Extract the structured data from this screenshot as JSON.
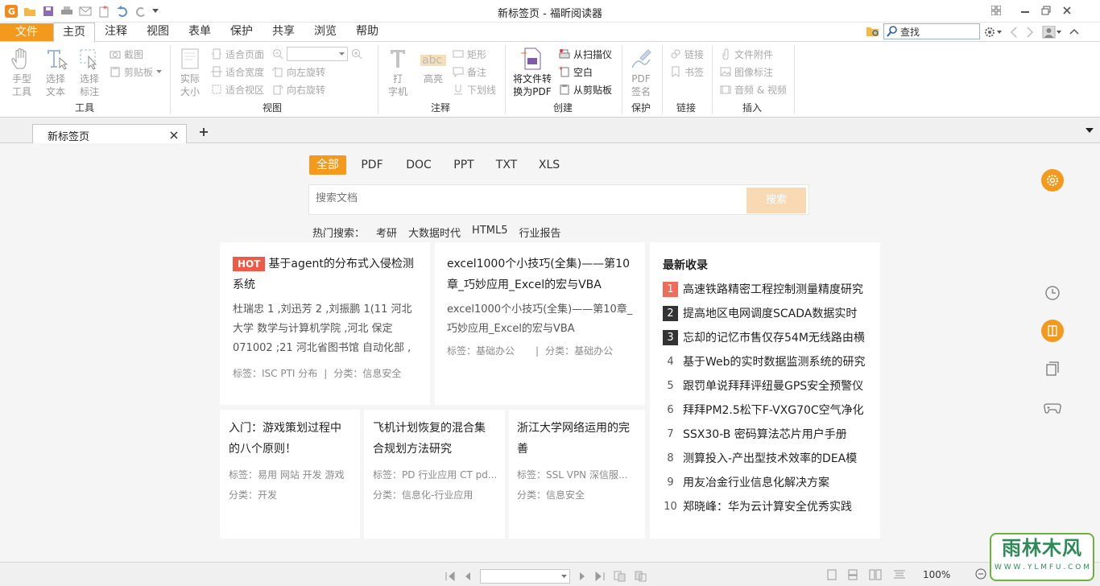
{
  "app": {
    "title": "新标签页 - 福昕阅读器"
  },
  "menu": {
    "tabs": [
      "文件",
      "主页",
      "注释",
      "视图",
      "表单",
      "保护",
      "共享",
      "浏览",
      "帮助"
    ],
    "search_placeholder": "查找"
  },
  "ribbon": {
    "tools": {
      "hand": "手型\n工具",
      "select_text": "选择\n文本",
      "select_annot": "选择\n标注",
      "snapshot": "截图",
      "clipboard": "剪贴板",
      "group": "工具"
    },
    "view": {
      "actual_size": "实际\n大小",
      "fit_page": "适合页面",
      "fit_width": "适合宽度",
      "fit_visible": "适合视区",
      "rotate_left": "向左旋转",
      "rotate_right": "向右旋转",
      "group": "视图"
    },
    "annot": {
      "typewriter": "打\n字机",
      "highlight": "高亮",
      "rectangle": "矩形",
      "note": "备注",
      "underline": "下划线",
      "group": "注释",
      "abc": "abc"
    },
    "create": {
      "to_pdf": "将文件转\n换为PDF",
      "from_scanner": "从扫描仪",
      "blank": "空白",
      "from_clipboard": "从剪贴板",
      "group": "创建"
    },
    "protect": {
      "pdf_sign": "PDF\n签名",
      "group": "保护"
    },
    "links": {
      "link": "链接",
      "bookmark": "书签",
      "group": "链接"
    },
    "insert": {
      "file_attach": "文件附件",
      "image_annot": "图像标注",
      "audio_video": "音频 & 视频",
      "group": "插入"
    }
  },
  "doc_tab": {
    "label": "新标签页"
  },
  "filters": [
    "全部",
    "PDF",
    "DOC",
    "PPT",
    "TXT",
    "XLS"
  ],
  "search": {
    "placeholder": "搜索文档",
    "button": "搜索"
  },
  "hot_search": {
    "label": "热门搜索：",
    "terms": [
      "考研",
      "大数据时代",
      "HTML5",
      "行业报告"
    ]
  },
  "cards": [
    {
      "badge": "HOT",
      "title": "基于agent的分布式入侵检测系统",
      "desc": "杜瑞忠 1 ,刘迅芳 2 ,刘振鹏 1(11 河北大学 数学与计算机学院 ,河北 保定 071002 ;21 河北省图书馆 自动化部 ,河",
      "tags": "标签：ISC PTI 分布",
      "category": "分类：信息安全"
    },
    {
      "title": "excel1000个小技巧(全集)——第10章_巧妙应用_Excel的宏与VBA",
      "desc": "excel1000个小技巧(全集)——第10章_巧妙应用_Excel的宏与VBA",
      "tags": "标签：基础办公",
      "category": "分类：基础办公"
    },
    {
      "title": "入门：游戏策划过程中的八个原则！",
      "tags": "标签：易用 网站 开发 游戏",
      "category": "分类：开发"
    },
    {
      "title": "飞机计划恢复的混合集合规划方法研究",
      "tags": "标签：PD 行业应用 CT pd...",
      "category": "分类：信息化-行业应用"
    },
    {
      "title": "浙江大学网络运用的完善",
      "tags": "标签：SSL VPN 深信服...",
      "category": "分类：信息安全"
    }
  ],
  "latest": {
    "title": "最新收录",
    "items": [
      "高速铁路精密工程控制测量精度研究",
      "提高地区电网调度SCADA数据实时",
      "忘却的记忆市售仅存54M无线路由横",
      "基于Web的实时数据监测系统的研究",
      "跟罚单说拜拜评纽曼GPS安全预警仪",
      "拜拜PM2.5松下F-VXG70C空气净化",
      "SSX30-B 密码算法芯片用户手册",
      "测算投入-产出型技术效率的DEA模",
      "用友冶金行业信息化解决方案",
      "郑晓峰：华为云计算安全优秀实践"
    ]
  },
  "status": {
    "zoom": "100%"
  },
  "watermark": {
    "name": "雨林木风",
    "url": "W W W . Y L M F U . C O M"
  },
  "colors": {
    "accent": "#f39a1e",
    "hot": "#ee5a45"
  }
}
